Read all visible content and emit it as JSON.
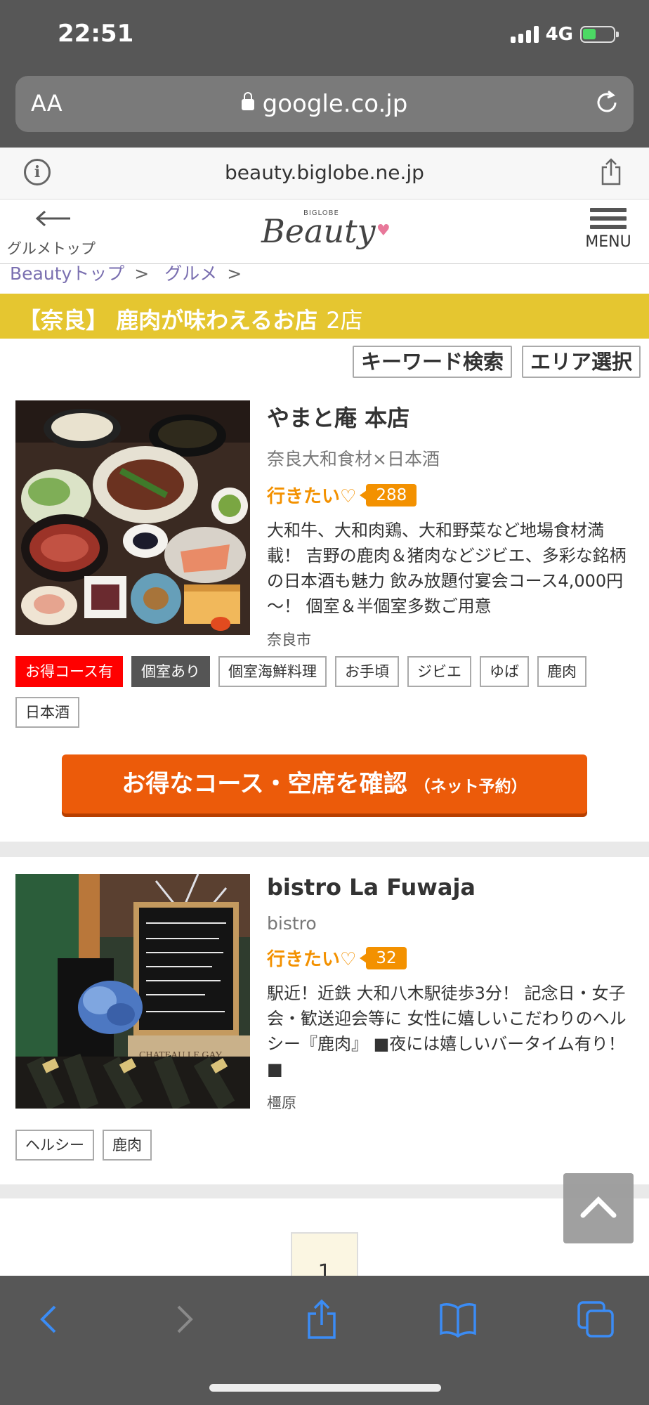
{
  "status": {
    "time": "22:51",
    "network": "4G"
  },
  "browser": {
    "aa_label": "AA",
    "url": "google.co.jp",
    "sub_domain": "beauty.biglobe.ne.jp"
  },
  "site_header": {
    "back_label": "グルメトップ",
    "logo_small": "BIGLOBE",
    "logo_main": "Beauty",
    "menu_label": "MENU"
  },
  "breadcrumb": [
    {
      "label": "Beautyトップ"
    },
    {
      "label": "グルメ"
    }
  ],
  "page_title": {
    "text": "【奈良】 鹿肉が味わえるお店",
    "count": "2店"
  },
  "search_buttons": {
    "keyword": "キーワード検索",
    "area": "エリア選択"
  },
  "want_label": "行きたい♡",
  "shops": [
    {
      "name": "やまと庵 本店",
      "genre": "奈良大和食材×日本酒",
      "want_count": "288",
      "description": "大和牛、大和肉鶏、大和野菜など地場食材満載！ 吉野の鹿肉＆猪肉などジビエ、多彩な銘柄の日本酒も魅力 飲み放題付宴会コース4,000円～！ 個室＆半個室多数ご用意",
      "area": "奈良市",
      "tags": [
        "お得コース有",
        "個室あり",
        "個室海鮮料理",
        "お手頃",
        "ジビエ",
        "ゆば",
        "鹿肉",
        "日本酒"
      ]
    },
    {
      "name": "bistro La Fuwaja",
      "genre": "bistro",
      "want_count": "32",
      "description": "駅近！近鉄 大和八木駅徒歩3分！ 記念日・女子会・歓送迎会等に 女性に嬉しいこだわりのヘルシー『鹿肉』 ■夜には嬉しいバータイム有り！■",
      "area": "橿原",
      "tags": [
        "ヘルシー",
        "鹿肉"
      ],
      "photo_text": "CHATEAU LE GAY"
    }
  ],
  "cta": {
    "label": "お得なコース・空席を確認",
    "sub_label": "（ネット予約）"
  },
  "pager": {
    "current": "1"
  },
  "colors": {
    "accent_yellow": "#e5c630",
    "cta_orange": "#ec5b0a",
    "want_orange": "#f39100",
    "tag_red": "#ff0000"
  }
}
